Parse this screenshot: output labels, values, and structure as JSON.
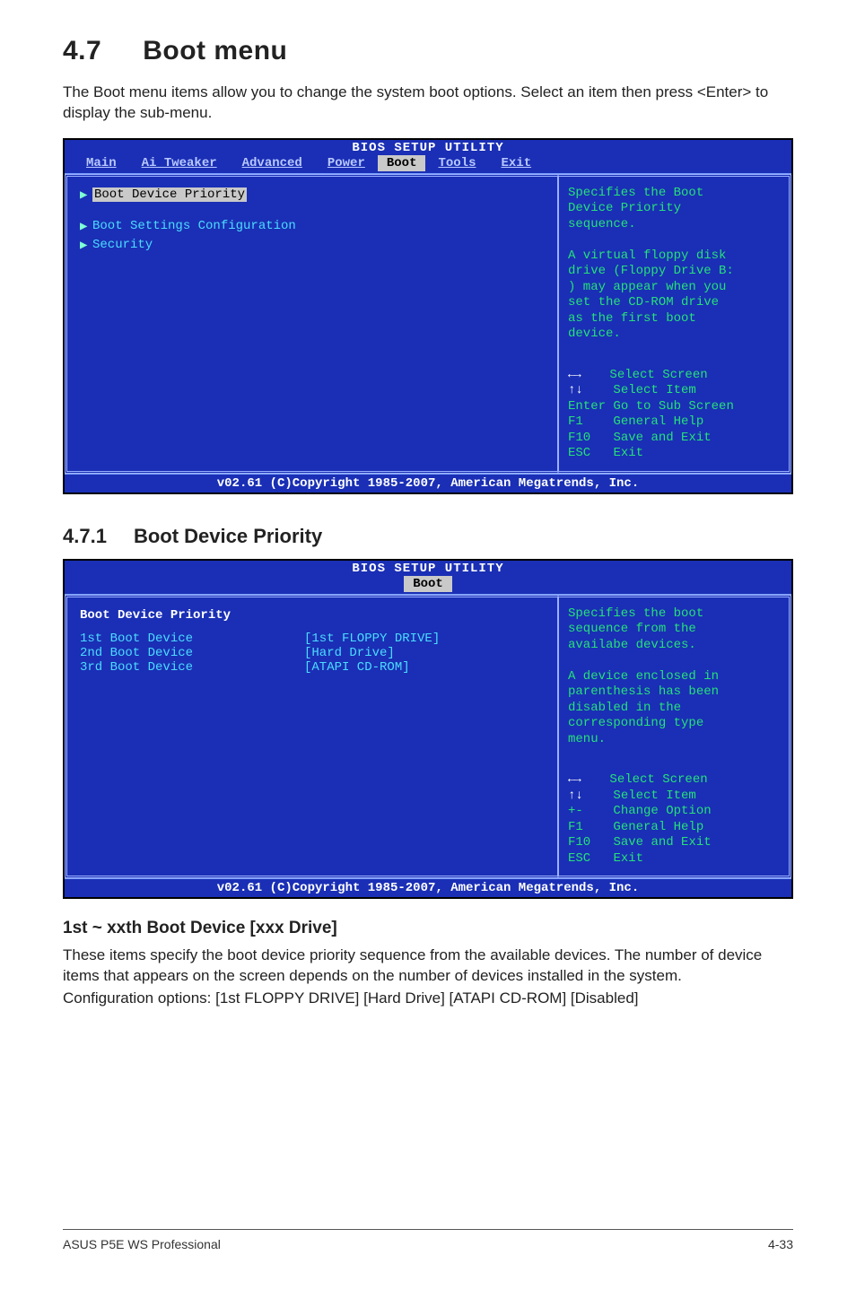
{
  "page": {
    "section_number": "4.7",
    "section_title": "Boot menu",
    "intro": "The Boot menu items allow you to change the system boot options. Select an item then press <Enter> to display the sub-menu.",
    "subsection_number": "4.7.1",
    "subsection_title": "Boot Device Priority",
    "option_title": "1st ~ xxth Boot Device [xxx Drive]",
    "option_body1": "These items specify the boot device priority sequence from the available devices. The number of device items that appears on the screen depends on the number of devices installed in the system.",
    "option_body2": "Configuration options: [1st FLOPPY DRIVE] [Hard Drive] [ATAPI CD-ROM] [Disabled]",
    "footer_left": "ASUS P5E WS Professional",
    "footer_right": "4-33"
  },
  "bios1": {
    "title": "BIOS SETUP UTILITY",
    "tabs": {
      "main": "Main",
      "ai": "Ai Tweaker",
      "adv": "Advanced",
      "power": "Power",
      "boot": "Boot",
      "tools": "Tools",
      "exit": "Exit"
    },
    "items": {
      "bdp": "Boot Device Priority",
      "bsc": "Boot Settings Configuration",
      "sec": "Security"
    },
    "help": "Specifies the Boot\nDevice Priority\nsequence.\n\nA virtual floppy disk\ndrive (Floppy Drive B:\n) may appear when you\nset the CD-ROM drive\nas the first boot\ndevice.",
    "keys": {
      "screen": "Select Screen",
      "item": "Select Item",
      "sub_pre": "Enter",
      "sub": "Go to Sub Screen",
      "f1_pre": "F1",
      "f1": "General Help",
      "f10_pre": "F10",
      "f10": "Save and Exit",
      "esc_pre": "ESC",
      "esc": "Exit"
    },
    "copyright": "v02.61 (C)Copyright 1985-2007, American Megatrends, Inc."
  },
  "bios2": {
    "title": "BIOS SETUP UTILITY",
    "tab_boot": "Boot",
    "heading": "Boot Device Priority",
    "rows": {
      "r1l": "1st Boot Device",
      "r1v": "[1st FLOPPY DRIVE]",
      "r2l": "2nd Boot Device",
      "r2v": "[Hard Drive]",
      "r3l": "3rd Boot Device",
      "r3v": "[ATAPI CD-ROM]"
    },
    "help": "Specifies the boot\nsequence from the\navailabe devices.\n\nA device enclosed in\nparenthesis has been\ndisabled in the\ncorresponding type\nmenu.",
    "keys": {
      "screen": "Select Screen",
      "item": "Select Item",
      "chg_pre": "+-",
      "chg": "Change Option",
      "f1_pre": "F1",
      "f1": "General Help",
      "f10_pre": "F10",
      "f10": "Save and Exit",
      "esc_pre": "ESC",
      "esc": "Exit"
    },
    "copyright": "v02.61 (C)Copyright 1985-2007, American Megatrends, Inc."
  },
  "chart_data": null
}
